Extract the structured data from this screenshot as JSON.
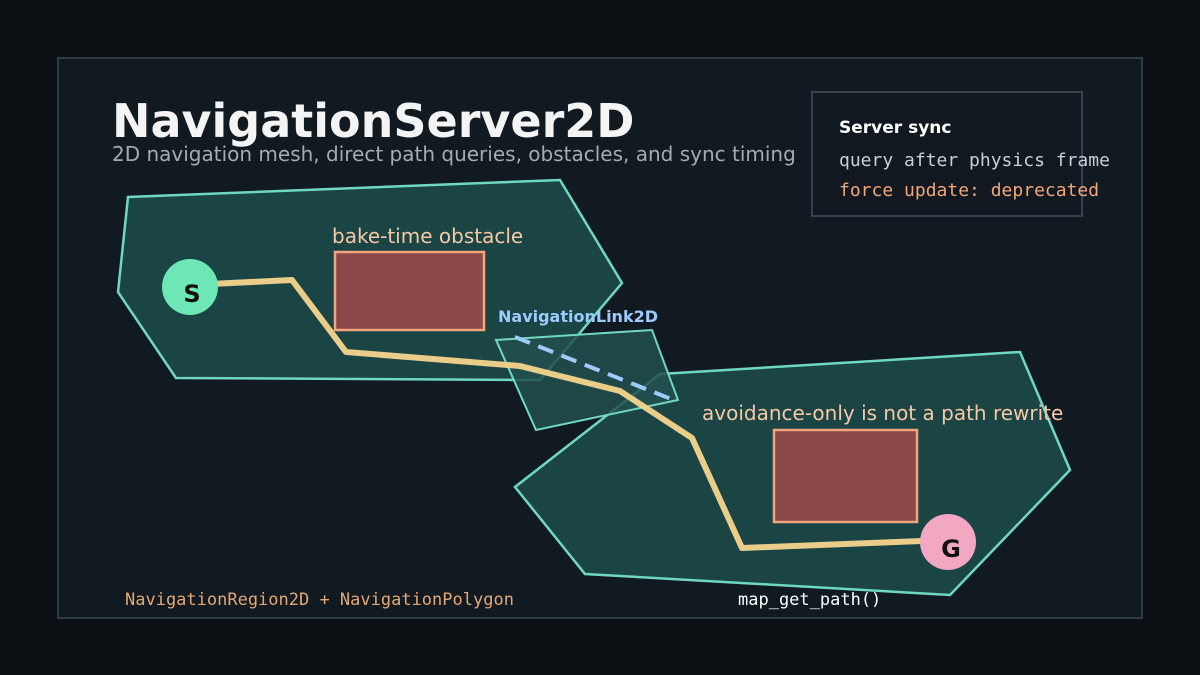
{
  "title": "NavigationServer2D",
  "subtitle": "2D navigation mesh, direct path queries, obstacles, and sync timing",
  "sync_panel": {
    "heading": "Server sync",
    "line1": "query after physics frame",
    "line2": "force update: deprecated"
  },
  "labels": {
    "bake_obstacle": "bake-time obstacle",
    "link": "NavigationLink2D",
    "avoidance": "avoidance-only is not a path rewrite",
    "region": "NavigationRegion2D + NavigationPolygon",
    "path_call": "map_get_path()"
  },
  "nodes": {
    "start": "S",
    "goal": "G"
  },
  "colors": {
    "background": "#0d1116",
    "panel": "#121a21",
    "region_fill": "#1b4444",
    "region_stroke": "#6fd8c0",
    "obstacle_fill": "#8a4848",
    "obstacle_stroke": "#f2a679",
    "path": "#f4d58d",
    "link": "#9ecbff",
    "start_node": "#6ee7b7",
    "goal_node": "#f2a7c3",
    "warning_text": "#f2a679"
  }
}
